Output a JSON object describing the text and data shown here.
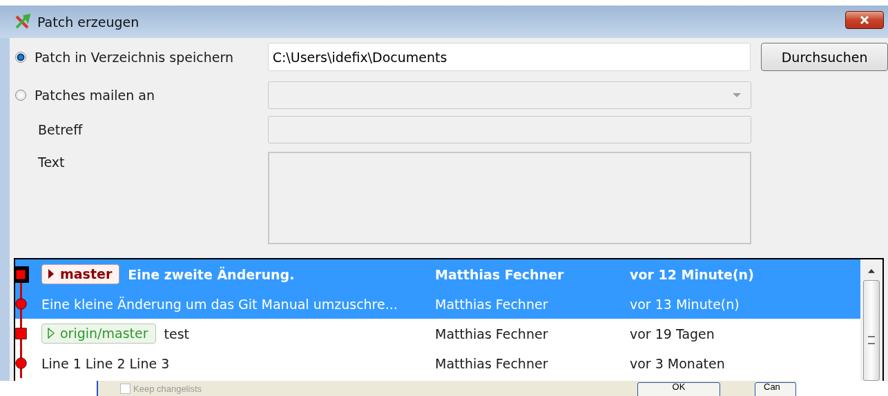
{
  "window": {
    "title": "Patch erzeugen"
  },
  "options": [
    {
      "label": "Patch in Verzeichnis speichern",
      "selected": true
    },
    {
      "label": "Patches mailen an",
      "selected": false
    }
  ],
  "directory_field": {
    "value": "C:\\Users\\idefix\\Documents"
  },
  "browse_button": "Durchsuchen",
  "mail_fields_disabled": true,
  "subject": {
    "label": "Betreff"
  },
  "text": {
    "label": "Text"
  },
  "commits": [
    {
      "kind": "square",
      "head": true,
      "selected": true,
      "refs": [
        {
          "label": "master",
          "kind": "local"
        }
      ],
      "message": "Eine zweite Änderung.",
      "author": "Matthias Fechner",
      "date": "vor 12 Minute(n)"
    },
    {
      "kind": "circle",
      "head": false,
      "selected": true,
      "message": "Eine kleine Änderung um das Git Manual umzuschre...",
      "author": "Matthias Fechner",
      "date": "vor 13 Minute(n)"
    },
    {
      "kind": "square",
      "head": false,
      "selected": false,
      "refs": [
        {
          "label": "origin/master",
          "kind": "remote"
        }
      ],
      "message": "test",
      "author": "Matthias Fechner",
      "date": "vor 19 Tagen"
    },
    {
      "kind": "circle",
      "head": false,
      "selected": false,
      "message": "Line 1 Line 2 Line 3",
      "author": "Matthias Fechner",
      "date": "vor 3 Monaten"
    }
  ],
  "overlay_dialog": {
    "checkbox": {
      "label": "Keep changelists",
      "checked": false
    },
    "buttons": [
      "OK",
      "Can"
    ]
  }
}
